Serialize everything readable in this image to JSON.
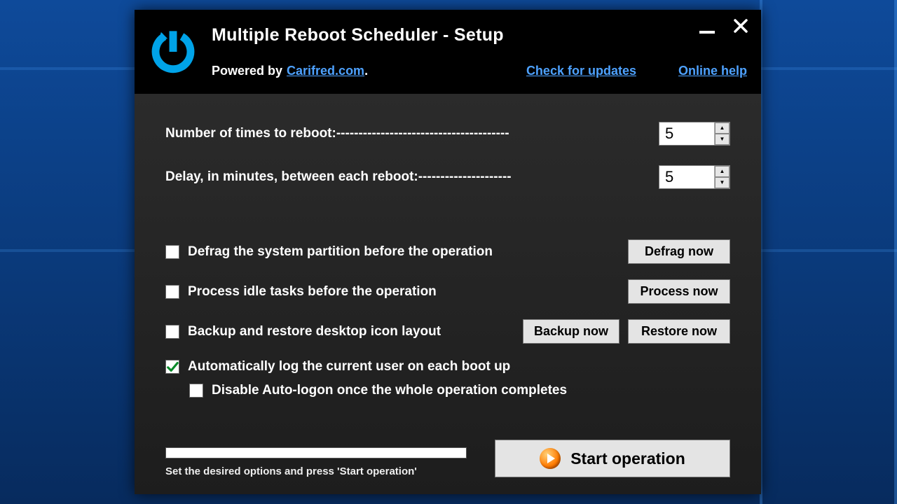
{
  "window": {
    "title": "Multiple Reboot Scheduler - Setup",
    "powered_by_prefix": "Powered by ",
    "powered_by_link": "Carifred.com",
    "powered_by_suffix": ".",
    "check_updates": "Check for updates",
    "online_help": "Online help"
  },
  "inputs": {
    "reboot_count_label": "Number of times to reboot:---------------------------------------",
    "reboot_count_value": "5",
    "delay_label": "Delay, in minutes, between each reboot:---------------------",
    "delay_value": "5"
  },
  "options": {
    "defrag": {
      "label": "Defrag the system partition before the operation",
      "checked": false,
      "button": "Defrag now"
    },
    "idle": {
      "label": "Process idle tasks before the operation",
      "checked": false,
      "button": "Process now"
    },
    "backup": {
      "label": "Backup and restore desktop icon layout",
      "checked": false,
      "backup_btn": "Backup now",
      "restore_btn": "Restore now"
    },
    "autolog": {
      "label": "Automatically log the current user on each boot up",
      "checked": true
    },
    "disable_autolog": {
      "label": "Disable Auto-logon once the whole operation completes",
      "checked": false
    }
  },
  "footer": {
    "hint": "Set the desired options and press 'Start operation'",
    "start": "Start operation"
  }
}
